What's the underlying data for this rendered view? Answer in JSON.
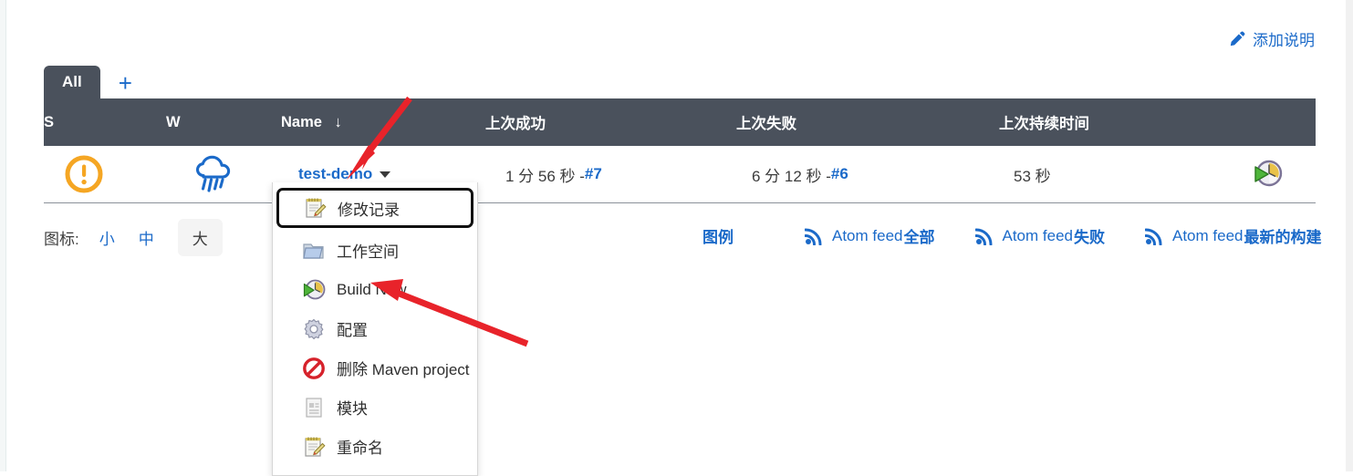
{
  "header": {
    "add_description_label": "添加说明",
    "add_description_icon": "pencil-icon"
  },
  "tabs": {
    "items": [
      {
        "label": "All",
        "selected": true
      }
    ],
    "add_label": "+"
  },
  "table": {
    "columns": [
      {
        "key": "s",
        "label": "S"
      },
      {
        "key": "w",
        "label": "W"
      },
      {
        "key": "name",
        "label": "Name",
        "sort_indicator": "↓"
      },
      {
        "key": "last_success",
        "label": "上次成功"
      },
      {
        "key": "last_failure",
        "label": "上次失败"
      },
      {
        "key": "last_duration",
        "label": "上次持续时间"
      },
      {
        "key": "build",
        "label": ""
      }
    ],
    "rows": [
      {
        "status_icon": "warning-circle-icon",
        "weather_icon": "rainy-cloud-icon",
        "name": "test-demo",
        "last_success_time": "1 分 56 秒 - ",
        "last_success_build": "#7",
        "last_failure_time": "6 分 12 秒 - ",
        "last_failure_build": "#6",
        "last_duration": "53 秒",
        "build_icon": "build-now-clock-icon"
      }
    ]
  },
  "context_menu": {
    "items": [
      {
        "label": "修改记录",
        "icon": "notepad-pencil-icon",
        "focused": true
      },
      {
        "label": "工作空间",
        "icon": "folder-icon",
        "focused": false
      },
      {
        "label": "Build Now",
        "icon": "build-now-clock-icon",
        "focused": false
      },
      {
        "label": "配置",
        "icon": "gear-icon",
        "focused": false
      },
      {
        "label": "删除 Maven project",
        "icon": "delete-forbidden-icon",
        "focused": false
      },
      {
        "label": "模块",
        "icon": "document-module-icon",
        "focused": false
      },
      {
        "label": "重命名",
        "icon": "notepad-pencil-icon",
        "focused": false
      }
    ]
  },
  "icon_size": {
    "label": "图标:",
    "options": [
      {
        "label": "小",
        "selected": false
      },
      {
        "label": "中",
        "selected": false
      },
      {
        "label": "大",
        "selected": true
      }
    ]
  },
  "feeds": {
    "legend_label": "图例",
    "items": [
      {
        "prefix": "Atom feed ",
        "suffix": "全部",
        "icon": "rss-icon"
      },
      {
        "prefix": "Atom feed ",
        "suffix": "失败",
        "icon": "rss-icon"
      },
      {
        "prefix": "Atom feed ",
        "suffix": "最新的构建",
        "icon": "rss-icon"
      }
    ]
  },
  "colors": {
    "header_bar": "#4a515c",
    "link_blue": "#1b6ac9",
    "status_warning_orange": "#f5a623",
    "annotation_red": "#e8232a"
  }
}
